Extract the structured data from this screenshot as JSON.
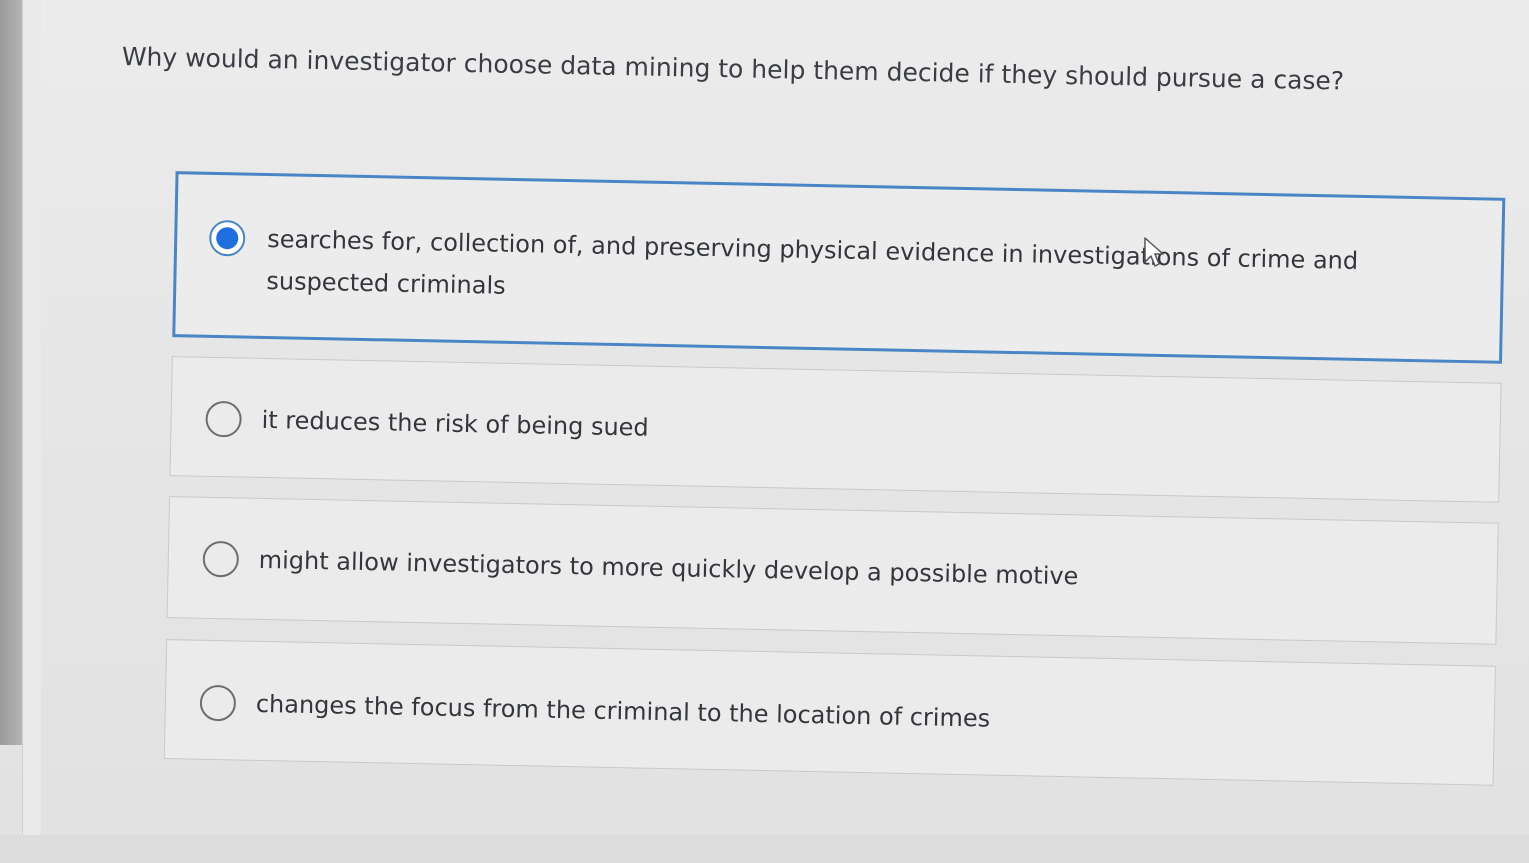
{
  "question": {
    "text": "Why would an investigator choose data mining to help them decide if they should pursue a case?"
  },
  "options": [
    {
      "label": "searches for, collection of, and preserving physical evidence in investigations of crime and suspected criminals",
      "selected": true
    },
    {
      "label": "it reduces the risk of being sued",
      "selected": false
    },
    {
      "label": "might allow investigators to more quickly develop a possible motive",
      "selected": false
    },
    {
      "label": "changes the focus from the criminal to the location of crimes",
      "selected": false
    }
  ],
  "colors": {
    "selected_border": "#4a86c6",
    "radio_fill": "#1f6fe0",
    "background": "#e8e8e8",
    "text": "#33363c"
  },
  "icons": {
    "cursor": "arrow-cursor-icon"
  }
}
